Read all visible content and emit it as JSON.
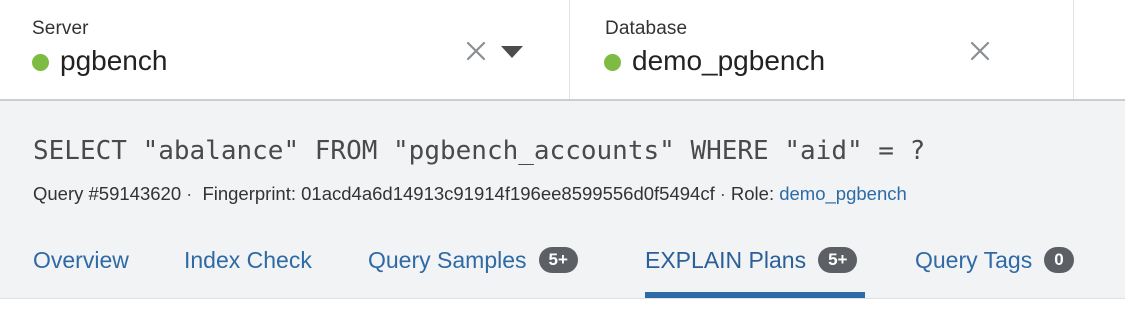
{
  "selectors": {
    "server": {
      "label": "Server",
      "value": "pgbench",
      "status_color": "#7dbb42"
    },
    "database": {
      "label": "Database",
      "value": "demo_pgbench",
      "status_color": "#7dbb42"
    }
  },
  "query": {
    "text": "SELECT \"abalance\" FROM \"pgbench_accounts\" WHERE \"aid\" = ?",
    "id_text": "Query #59143620",
    "fingerprint_text": "Fingerprint: 01acd4a6d14913c91914f196ee8599556d0f5494cf",
    "role_label": "Role:",
    "role_value": "demo_pgbench",
    "separator": "·"
  },
  "tabs": [
    {
      "label": "Overview",
      "badge": null,
      "active": false
    },
    {
      "label": "Index Check",
      "badge": null,
      "active": false
    },
    {
      "label": "Query Samples",
      "badge": "5+",
      "active": false
    },
    {
      "label": "EXPLAIN Plans",
      "badge": "5+",
      "active": true
    },
    {
      "label": "Query Tags",
      "badge": "0",
      "active": false
    }
  ],
  "colors": {
    "link": "#2f6aa6",
    "badge_bg": "#5c5f63",
    "header_bg": "#f1f3f5",
    "status_ok": "#7dbb42"
  },
  "icons": {
    "clear": "close-icon",
    "dropdown": "caret-down-icon"
  }
}
